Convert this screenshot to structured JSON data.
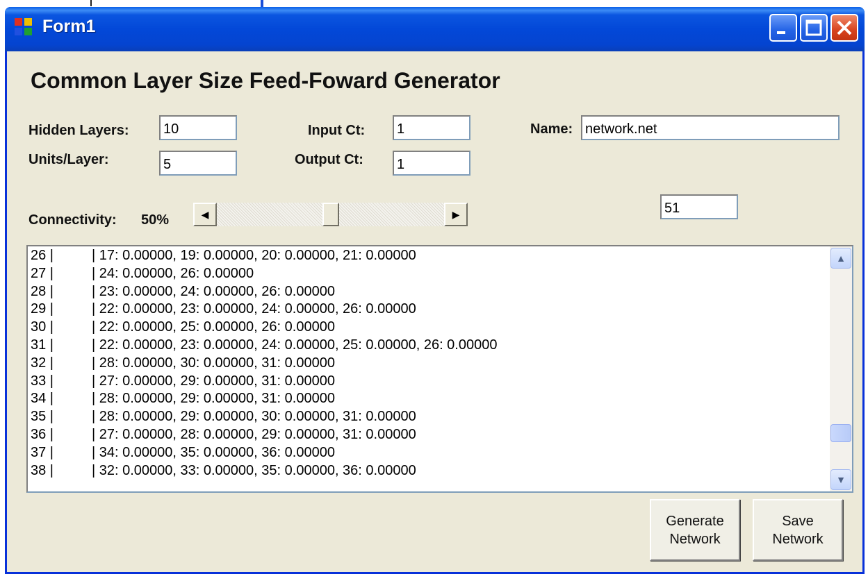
{
  "window": {
    "title": "Form1"
  },
  "heading": "Common Layer Size Feed-Foward Generator",
  "fields": {
    "hidden_layers": {
      "label": "Hidden Layers:",
      "value": "10"
    },
    "units_layer": {
      "label": "Units/Layer:",
      "value": "5"
    },
    "input_ct": {
      "label": "Input Ct:",
      "value": "1"
    },
    "output_ct": {
      "label": "Output Ct:",
      "value": "1"
    },
    "name": {
      "label": "Name:",
      "value": "network.net"
    }
  },
  "connectivity": {
    "label": "Connectivity:",
    "value_text": "50%",
    "slider_fraction": 0.5
  },
  "count_box": {
    "value": "51"
  },
  "list": [
    {
      "idx": "26 |",
      "text": "| 17: 0.00000, 19: 0.00000, 20: 0.00000, 21: 0.00000"
    },
    {
      "idx": "27 |",
      "text": "| 24: 0.00000, 26: 0.00000"
    },
    {
      "idx": "28 |",
      "text": "| 23: 0.00000, 24: 0.00000, 26: 0.00000"
    },
    {
      "idx": "29 |",
      "text": "| 22: 0.00000, 23: 0.00000, 24: 0.00000, 26: 0.00000"
    },
    {
      "idx": "30 |",
      "text": "| 22: 0.00000, 25: 0.00000, 26: 0.00000"
    },
    {
      "idx": "31 |",
      "text": "| 22: 0.00000, 23: 0.00000, 24: 0.00000, 25: 0.00000, 26: 0.00000"
    },
    {
      "idx": "32 |",
      "text": "| 28: 0.00000, 30: 0.00000, 31: 0.00000"
    },
    {
      "idx": "33 |",
      "text": "| 27: 0.00000, 29: 0.00000, 31: 0.00000"
    },
    {
      "idx": "34 |",
      "text": "| 28: 0.00000, 29: 0.00000, 31: 0.00000"
    },
    {
      "idx": "35 |",
      "text": "| 28: 0.00000, 29: 0.00000, 30: 0.00000, 31: 0.00000"
    },
    {
      "idx": "36 |",
      "text": "| 27: 0.00000, 28: 0.00000, 29: 0.00000, 31: 0.00000"
    },
    {
      "idx": "37 |",
      "text": "| 34: 0.00000, 35: 0.00000, 36: 0.00000"
    },
    {
      "idx": "38 |",
      "text": "| 32: 0.00000, 33: 0.00000, 35: 0.00000, 36: 0.00000"
    }
  ],
  "buttons": {
    "generate": "Generate\nNetwork",
    "save": "Save\nNetwork"
  },
  "colors": {
    "titlebar": "#0348d8",
    "form_bg": "#ece9d8",
    "close_button": "#d8431e"
  },
  "icons": [
    "app-icon",
    "minimize-icon",
    "maximize-icon",
    "close-icon",
    "arrow-left-icon",
    "arrow-right-icon",
    "arrow-up-icon",
    "arrow-down-icon"
  ]
}
